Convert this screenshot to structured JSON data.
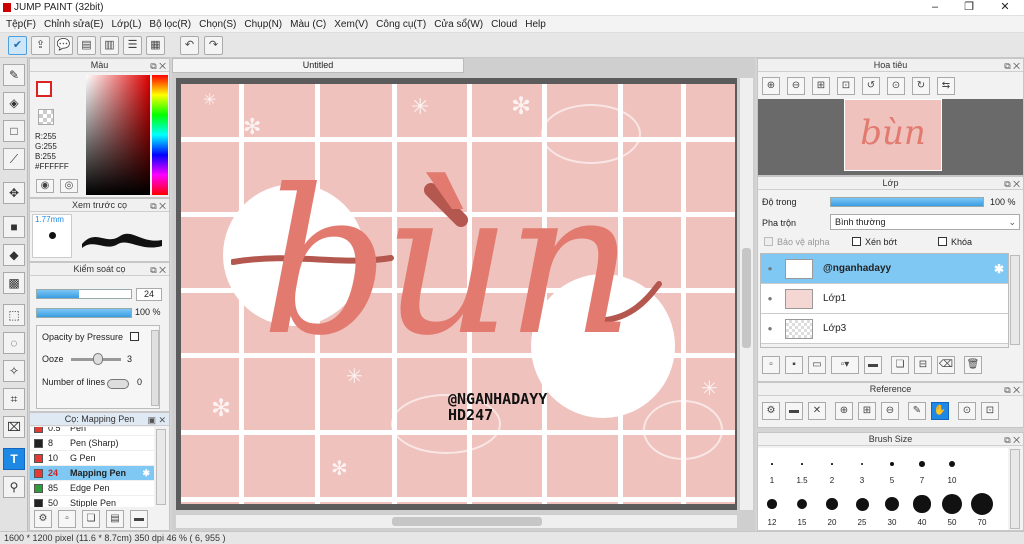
{
  "window": {
    "title": "JUMP PAINT (32bit)",
    "min": "–",
    "max": "❐",
    "close": "✕"
  },
  "menu": [
    "Tệp(F)",
    "Chỉnh sửa(E)",
    "Lớp(L)",
    "Bộ lọc(R)",
    "Chọn(S)",
    "Chụp(N)",
    "Màu (C)",
    "Xem(V)",
    "Công cụ(T)",
    "Cửa sổ(W)",
    "Cloud",
    "Help"
  ],
  "color_panel": {
    "title": "Màu",
    "r": "R:255",
    "g": "G:255",
    "b": "B:255",
    "hex": "#FFFFFF"
  },
  "preview_panel": {
    "title": "Xem trước cọ",
    "size": "1.77mm"
  },
  "control_panel": {
    "title": "Kiểm soát cọ",
    "size_value": "24",
    "opacity_value": "100 %",
    "size_level": 0.45,
    "opacity_level": 1.0,
    "pressure_label": "Opacity by Pressure",
    "ooze_label": "Ooze",
    "ooze_value": "3",
    "lines_label": "Number of lines",
    "lines_value": "0"
  },
  "brush_panel": {
    "title": "Cọ: Mapping Pen",
    "brushes": [
      {
        "size": "0.5",
        "name": "Pen",
        "color": "#e53935"
      },
      {
        "size": "8",
        "name": "Pen (Sharp)",
        "color": "#222222"
      },
      {
        "size": "10",
        "name": "G Pen",
        "color": "#e53935"
      },
      {
        "size": "24",
        "name": "Mapping Pen",
        "color": "#e53935",
        "selected": true
      },
      {
        "size": "85",
        "name": "Edge Pen",
        "color": "#2e9e3a"
      },
      {
        "size": "50",
        "name": "Stipple Pen",
        "color": "#222222"
      }
    ]
  },
  "document": {
    "tab": "Untitled",
    "artwork_text": "bùn",
    "handle": "@NGANHADAYY",
    "code": "HD247"
  },
  "status": {
    "text": "1600 * 1200 pixel   (11.6 * 8.7cm)   350 dpi   46 %   ( 6, 955 )"
  },
  "navigator": {
    "title": "Hoa tiêu"
  },
  "layers": {
    "title": "Lớp",
    "opacity_label": "Độ trong",
    "opacity_value": "100 %",
    "opacity_level": 1.0,
    "blend_label": "Pha trộn",
    "blend_value": "Bình thường",
    "protect_alpha": "Bảo vệ alpha",
    "clipping": "Xén bớt",
    "lock": "Khóa",
    "items": [
      {
        "name": "@nganhadayy",
        "selected": true
      },
      {
        "name": "Lớp1",
        "selected": false
      },
      {
        "name": "Lớp3",
        "selected": false
      }
    ]
  },
  "reference": {
    "title": "Reference"
  },
  "brush_size": {
    "title": "Brush Size",
    "labels_row1": [
      "1",
      "1.5",
      "2",
      "3",
      "5",
      "7",
      "10"
    ],
    "labels_row2": [
      "12",
      "15",
      "20",
      "25",
      "30",
      "40",
      "50",
      "70"
    ]
  },
  "colors": {
    "accent": "#1e88e5",
    "selection": "#7ec8f3",
    "artwork_bg": "#efc2bd",
    "lettering": "#e27a6f",
    "lettering_dark": "#b4574f"
  }
}
